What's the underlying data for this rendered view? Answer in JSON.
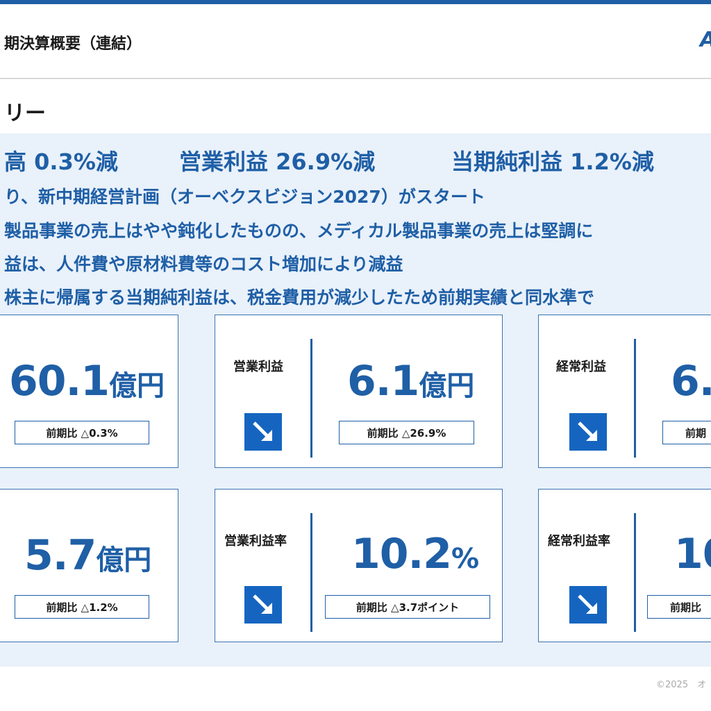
{
  "header": {
    "title": "期決算概要（連結）",
    "logo_text": "A"
  },
  "section_title": "リー",
  "headlines": [
    "高 0.3%減",
    "営業利益 26.9%減",
    "当期純利益 1.2%減"
  ],
  "bullets": [
    "り、新中期経営計画（オーベクスビジョン2027）がスタート",
    "製品事業の売上はやや鈍化したものの、メディカル製品事業の売上は堅調に",
    "益は、人件費や原材料費等のコスト増加により減益",
    "株主に帰属する当期純利益は、税金費用が減少したため前期実績と同水準で"
  ],
  "cards": [
    {
      "label": "",
      "value": "60.1",
      "unit": "億円",
      "comparison": "前期比 △0.3%"
    },
    {
      "label": "営業利益",
      "value": "6.1",
      "unit": "億円",
      "comparison": "前期比 △26.9%",
      "trend": "down"
    },
    {
      "label": "経常利益",
      "value": "6.",
      "unit": "",
      "comparison": "前期",
      "trend": "down"
    },
    {
      "label": "",
      "value": "5.7",
      "unit": "億円",
      "comparison": "前期比 △1.2%"
    },
    {
      "label": "営業利益率",
      "value": "10.2",
      "unit": "%",
      "comparison": "前期比 △3.7ポイント",
      "trend": "down"
    },
    {
      "label": "経常利益率",
      "value": "10",
      "unit": "",
      "comparison": "前期比 ",
      "trend": "down"
    }
  ],
  "footer": "©2025　オ",
  "colors": {
    "accent": "#1f5fa6",
    "arrow_bg": "#1565c0",
    "panel_bg": "#e9f1fa"
  },
  "icons": {
    "trend_down": "arrow-down-right-icon"
  }
}
